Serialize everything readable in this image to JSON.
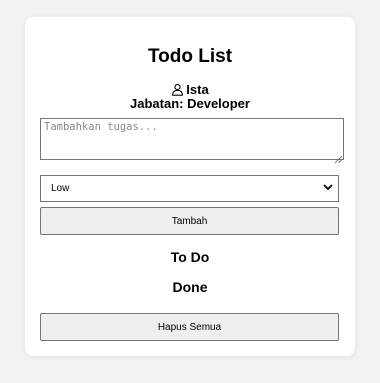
{
  "app": {
    "title": "Todo List"
  },
  "user": {
    "name": "Ista",
    "role_line": "Jabatan: Developer",
    "icon": "user-icon"
  },
  "task_input": {
    "value": "",
    "placeholder": "Tambahkan tugas..."
  },
  "priority_select": {
    "selected": "Low",
    "icon": "chevron-down-icon"
  },
  "buttons": {
    "add_label": "Tambah",
    "clear_all_label": "Hapus Semua"
  },
  "sections": {
    "todo_title": "To Do",
    "done_title": "Done"
  },
  "colors": {
    "page_background": "#f2f2f2",
    "card_background": "#ffffff",
    "button_background": "#efefef",
    "border": "#767676"
  }
}
